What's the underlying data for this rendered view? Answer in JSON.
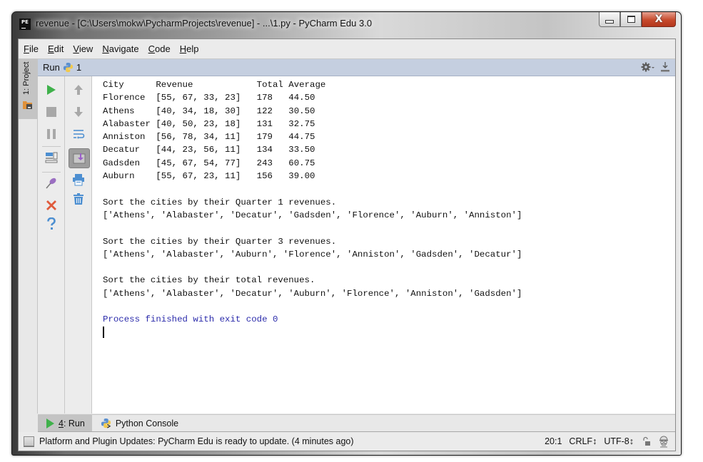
{
  "window": {
    "title": "revenue - [C:\\Users\\mokw\\PycharmProjects\\revenue] - ...\\1.py - PyCharm Edu 3.0",
    "app_icon_label": "PE",
    "buttons": {
      "minimize": "minimize",
      "maximize": "maximize",
      "close": "X"
    }
  },
  "menu": [
    {
      "label": "File",
      "mnemonic": "F",
      "rest": "ile"
    },
    {
      "label": "Edit",
      "mnemonic": "E",
      "rest": "dit"
    },
    {
      "label": "View",
      "mnemonic": "V",
      "rest": "iew"
    },
    {
      "label": "Navigate",
      "mnemonic": "N",
      "rest": "avigate"
    },
    {
      "label": "Code",
      "mnemonic": "C",
      "rest": "ode"
    },
    {
      "label": "Help",
      "mnemonic": "H",
      "rest": "elp"
    }
  ],
  "side_tabs": {
    "project": "1: Project"
  },
  "run_panel": {
    "title": "Run",
    "config_name": "1",
    "toolbar_left": [
      "run-icon",
      "stop-icon",
      "pause-icon",
      "layout-icon",
      "pin-icon",
      "close-icon",
      "help-icon"
    ],
    "toolbar_right": [
      "up-arrow-icon",
      "down-arrow-icon",
      "soft-wrap-icon",
      "scroll-to-end-icon",
      "print-icon",
      "trash-icon"
    ]
  },
  "console": {
    "table_header": [
      "City",
      "Revenue",
      "Total",
      "Average"
    ],
    "rows": [
      {
        "city": "Florence",
        "revenue": "[55, 67, 33, 23]",
        "total": "178",
        "average": "44.50"
      },
      {
        "city": "Athens",
        "revenue": "[40, 34, 18, 30]",
        "total": "122",
        "average": "30.50"
      },
      {
        "city": "Alabaster",
        "revenue": "[40, 50, 23, 18]",
        "total": "131",
        "average": "32.75"
      },
      {
        "city": "Anniston",
        "revenue": "[56, 78, 34, 11]",
        "total": "179",
        "average": "44.75"
      },
      {
        "city": "Decatur",
        "revenue": "[44, 23, 56, 11]",
        "total": "134",
        "average": "33.50"
      },
      {
        "city": "Gadsden",
        "revenue": "[45, 67, 54, 77]",
        "total": "243",
        "average": "60.75"
      },
      {
        "city": "Auburn",
        "revenue": "[55, 67, 23, 11]",
        "total": "156",
        "average": "39.00"
      }
    ],
    "sorts": [
      {
        "heading": "Sort the cities by their Quarter 1 revenues.",
        "result": "['Athens', 'Alabaster', 'Decatur', 'Gadsden', 'Florence', 'Auburn', 'Anniston']"
      },
      {
        "heading": "Sort the cities by their Quarter 3 revenues.",
        "result": "['Athens', 'Alabaster', 'Auburn', 'Florence', 'Anniston', 'Gadsden', 'Decatur']"
      },
      {
        "heading": "Sort the cities by their total revenues.",
        "result": "['Athens', 'Alabaster', 'Decatur', 'Auburn', 'Florence', 'Anniston', 'Gadsden']"
      }
    ],
    "exit_message": "Process finished with exit code 0"
  },
  "bottom_tabs": [
    {
      "label": "4: Run",
      "mnemonic": "4",
      "rest": ": Run",
      "active": true
    },
    {
      "label": "Python Console",
      "active": false
    }
  ],
  "statusbar": {
    "message": "Platform and Plugin Updates: PyCharm Edu is ready to update. (4 minutes ago)",
    "position": "20:1",
    "line_separator": "CRLF↕",
    "encoding": "UTF-8↕"
  },
  "colors": {
    "run_green": "#3fb14b",
    "exit_text_blue": "#2b2bab",
    "run_header_bg": "#c5cfe0",
    "close_red": "#c74a2d"
  }
}
